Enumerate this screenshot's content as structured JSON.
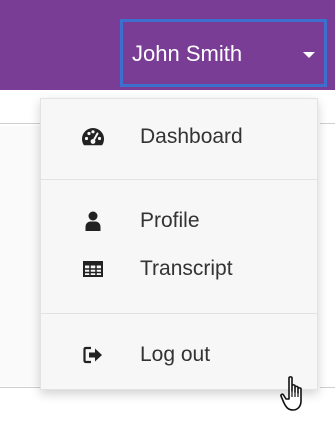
{
  "header": {
    "user_name": "John Smith",
    "caret_icon": "caret-down-icon"
  },
  "dropdown": {
    "items": [
      {
        "label": "Dashboard",
        "icon": "tachometer-icon"
      },
      {
        "label": "Profile",
        "icon": "user-icon"
      },
      {
        "label": "Transcript",
        "icon": "table-icon"
      },
      {
        "label": "Log out",
        "icon": "sign-out-icon"
      }
    ]
  },
  "colors": {
    "header_bg": "#7a3d96",
    "focus_border": "#3d6fcf",
    "menu_bg": "#f7f7f7",
    "menu_text": "#333333"
  },
  "cursor": "hand-pointer-icon"
}
